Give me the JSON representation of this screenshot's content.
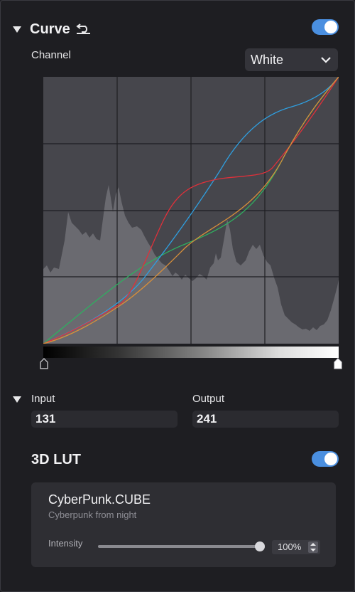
{
  "curve": {
    "title": "Curve",
    "enabled": true,
    "channel_label": "Channel",
    "channel_value": "White"
  },
  "io": {
    "input_label": "Input",
    "output_label": "Output",
    "input_value": "131",
    "output_value": "241"
  },
  "lut": {
    "title": "3D LUT",
    "enabled": true,
    "name": "CyberPunk.CUBE",
    "description": "Cyberpunk from night",
    "intensity_label": "Intensity",
    "intensity_value": "100%",
    "intensity_fraction": 1.0
  },
  "colors": {
    "accent": "#4a8fe0",
    "curve_white": "#d88f3a",
    "curve_red": "#e0303a",
    "curve_green": "#2eb060",
    "curve_blue": "#2f9fe0",
    "histogram": "#6e6e74"
  },
  "icons": {
    "collapse": "triangle-down-icon",
    "reset": "undo-icon",
    "dropdown": "chevron-down-icon"
  }
}
